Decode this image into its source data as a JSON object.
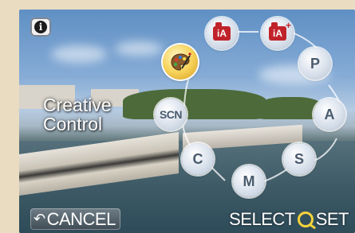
{
  "screen": {
    "info_icon": "info-icon",
    "mode_name_line1": "Creative",
    "mode_name_line2": "Control",
    "selected_mode": "Creative Control"
  },
  "mode_dial": {
    "items": [
      {
        "id": "intelligent-auto",
        "label": "iA",
        "icon": "camera-ia-icon"
      },
      {
        "id": "intelligent-auto-plus",
        "label": "iA",
        "icon": "camera-ia-plus-icon"
      },
      {
        "id": "program",
        "label": "P"
      },
      {
        "id": "aperture-priority",
        "label": "A"
      },
      {
        "id": "shutter-priority",
        "label": "S"
      },
      {
        "id": "manual",
        "label": "M"
      },
      {
        "id": "custom",
        "label": "C"
      },
      {
        "id": "scene",
        "label": "SCN"
      },
      {
        "id": "creative-control",
        "label": "",
        "icon": "palette-icon",
        "selected": true
      }
    ]
  },
  "footer": {
    "cancel_label": "CANCEL",
    "cancel_icon": "return-arrow-icon",
    "select_label": "SELECT",
    "set_label": "SET",
    "dial_icon": "control-dial-icon"
  },
  "colors": {
    "selected_mode": "#f7d35a",
    "mode_button": "#dfe6ef",
    "mode_text": "#4a5a6d",
    "ia_red": "#c0242a",
    "dial_yellow": "#f3d23b"
  }
}
